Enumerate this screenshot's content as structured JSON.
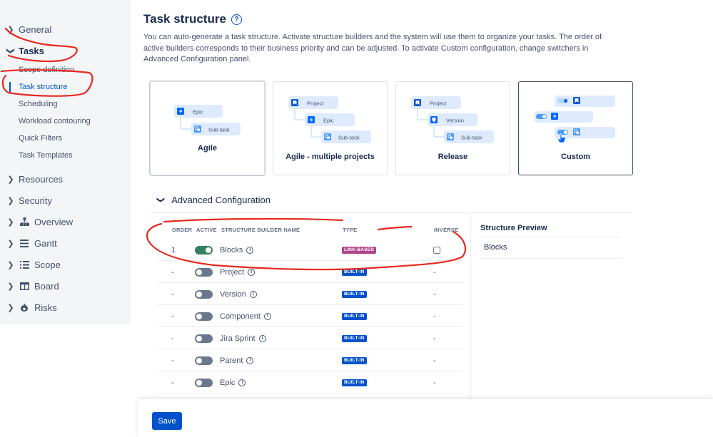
{
  "sidebar": {
    "items": [
      {
        "label": "General",
        "open": false
      },
      {
        "label": "Tasks",
        "open": true
      },
      {
        "label": "Resources",
        "open": false
      },
      {
        "label": "Security",
        "open": false
      },
      {
        "label": "Overview",
        "open": false,
        "icon": "hierarchy-icon"
      },
      {
        "label": "Gantt",
        "open": false,
        "icon": "list-indent-icon"
      },
      {
        "label": "Scope",
        "open": false,
        "icon": "bullet-list-icon"
      },
      {
        "label": "Board",
        "open": false,
        "icon": "board-icon"
      },
      {
        "label": "Risks",
        "open": false,
        "icon": "flame-icon"
      }
    ],
    "task_subitems": [
      "Scope definition",
      "Task structure",
      "Scheduling",
      "Workload contouring",
      "Quick Filters",
      "Task Templates"
    ],
    "active_subitem": "Task structure"
  },
  "header": {
    "title": "Task structure",
    "help_glyph": "?",
    "description": "You can auto-generate a task structure. Activate structure builders and the system will use them to organize your tasks. The order of active builders corresponds to their business priority and can be adjusted. To activate Custom configuration, change switchers in Advanced Configuration panel."
  },
  "cards": [
    {
      "label": "Agile",
      "nodes": [
        "Epic",
        "Sub-task"
      ]
    },
    {
      "label": "Agile - multiple projects",
      "nodes": [
        "Project",
        "Epic",
        "Sub-task"
      ]
    },
    {
      "label": "Release",
      "nodes": [
        "Project",
        "Version",
        "Sub-task"
      ]
    },
    {
      "label": "Custom",
      "selected": true
    }
  ],
  "advanced": {
    "label": "Advanced Configuration",
    "columns": {
      "order": "ORDER",
      "active": "ACTIVE",
      "name": "STRUCTURE BUILDER NAME",
      "type": "TYPE",
      "inverse": "INVERSE"
    },
    "rows": [
      {
        "order": "1",
        "active": true,
        "name": "Blocks",
        "type": "LINK-BASED",
        "inverse": "checkbox"
      },
      {
        "order": "-",
        "active": false,
        "name": "Project",
        "type": "BUILT-IN",
        "inverse": "-"
      },
      {
        "order": "-",
        "active": false,
        "name": "Version",
        "type": "BUILT-IN",
        "inverse": "-"
      },
      {
        "order": "-",
        "active": false,
        "name": "Component",
        "type": "BUILT-IN",
        "inverse": "-"
      },
      {
        "order": "-",
        "active": false,
        "name": "Jira Sprint",
        "type": "BUILT-IN",
        "inverse": "-"
      },
      {
        "order": "-",
        "active": false,
        "name": "Parent",
        "type": "BUILT-IN",
        "inverse": "-"
      },
      {
        "order": "-",
        "active": false,
        "name": "Epic",
        "type": "BUILT-IN",
        "inverse": "-"
      }
    ]
  },
  "preview": {
    "title": "Structure Preview",
    "items": [
      "Blocks"
    ]
  },
  "footer": {
    "save_label": "Save"
  },
  "colors": {
    "accent": "#0052cc",
    "toggle_on": "#36805b",
    "link_badge": "#b0458c",
    "annotation": "#e8281e"
  }
}
